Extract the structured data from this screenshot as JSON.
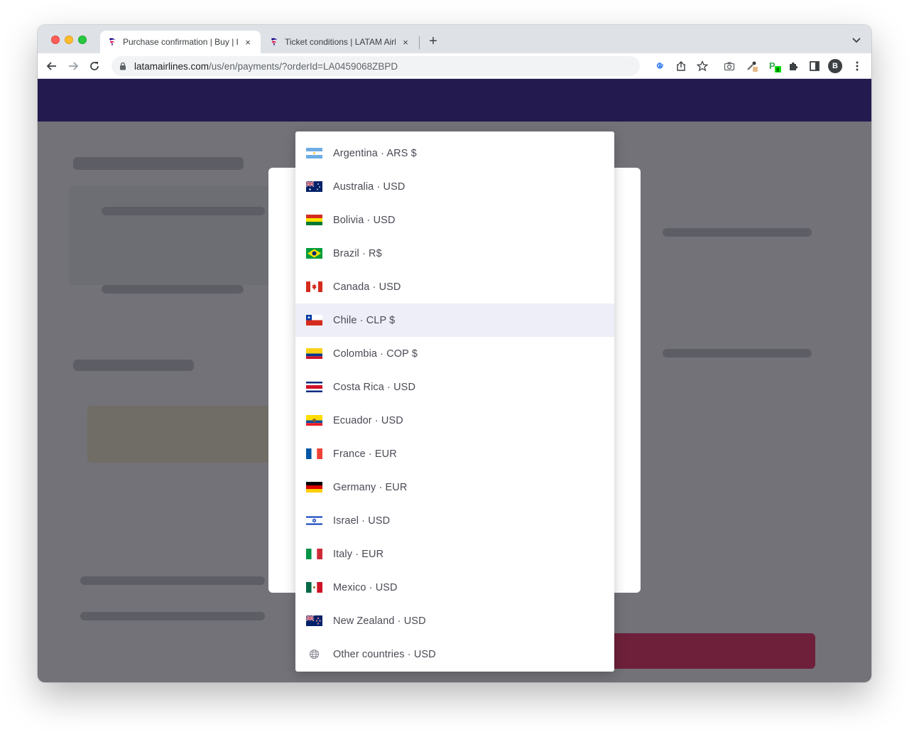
{
  "browser": {
    "tabs": [
      {
        "title": "Purchase confirmation | Buy | L",
        "active": true
      },
      {
        "title": "Ticket conditions | LATAM Airli",
        "active": false
      }
    ],
    "new_tab_label": "+",
    "close_label": "×",
    "url_host": "latamairlines.com",
    "url_path": "/us/en/payments/?orderId=LA0459068ZBPD",
    "profile_initial": "B"
  },
  "country_selector": {
    "selected": "Chile · CLP $",
    "options": [
      {
        "label": "Argentina · ARS $",
        "flag": "argentina-flag-icon"
      },
      {
        "label": "Australia · USD",
        "flag": "australia-flag-icon"
      },
      {
        "label": "Bolivia · USD",
        "flag": "bolivia-flag-icon"
      },
      {
        "label": "Brazil · R$",
        "flag": "brazil-flag-icon"
      },
      {
        "label": "Canada · USD",
        "flag": "canada-flag-icon"
      },
      {
        "label": "Chile · CLP $",
        "flag": "chile-flag-icon"
      },
      {
        "label": "Colombia · COP $",
        "flag": "colombia-flag-icon"
      },
      {
        "label": "Costa Rica · USD",
        "flag": "costa-rica-flag-icon"
      },
      {
        "label": "Ecuador · USD",
        "flag": "ecuador-flag-icon"
      },
      {
        "label": "France · EUR",
        "flag": "france-flag-icon"
      },
      {
        "label": "Germany · EUR",
        "flag": "germany-flag-icon"
      },
      {
        "label": "Israel · USD",
        "flag": "israel-flag-icon"
      },
      {
        "label": "Italy · EUR",
        "flag": "italy-flag-icon"
      },
      {
        "label": "Mexico · USD",
        "flag": "mexico-flag-icon"
      },
      {
        "label": "New Zealand · USD",
        "flag": "new-zealand-flag-icon"
      },
      {
        "label": "Other countries · USD",
        "flag": "globe-icon"
      }
    ]
  },
  "colors": {
    "brand_header": "#1b0088",
    "brand_accent": "#e8114b",
    "selected_row": "#eeeef8",
    "option_text": "#4a4a55"
  }
}
